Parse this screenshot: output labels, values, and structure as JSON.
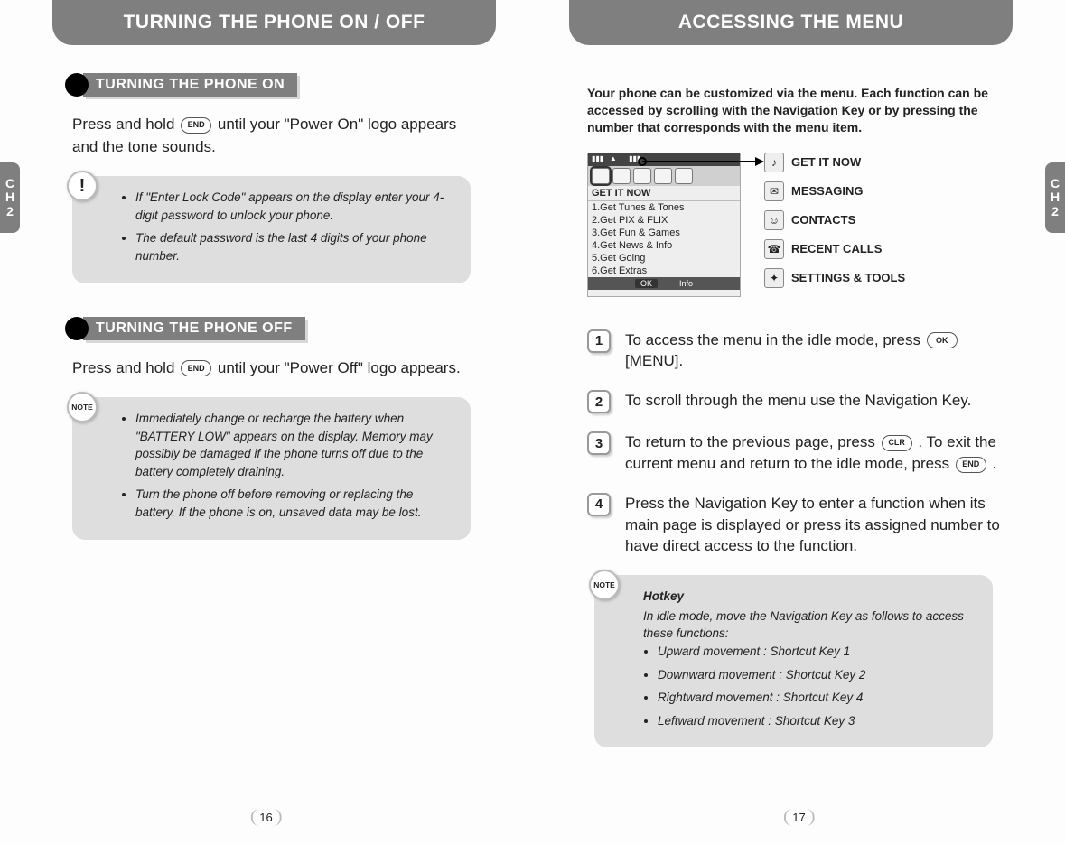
{
  "left": {
    "header": "TURNING THE PHONE ON / OFF",
    "side_tab": {
      "c": "C",
      "h": "H",
      "n": "2"
    },
    "sec1": {
      "title": "TURNING THE PHONE ON",
      "body_a": "Press and hold ",
      "key": "END",
      "body_b": " until your \"Power On\" logo appears and the tone sounds.",
      "note_badge": "!",
      "note_items": [
        "If \"Enter Lock Code\" appears on the display enter your 4-digit password to unlock your phone.",
        "The default password is the last 4 digits of your phone number."
      ]
    },
    "sec2": {
      "title": "TURNING THE PHONE OFF",
      "body_a": "Press and hold ",
      "key": "END",
      "body_b": " until your \"Power Off\" logo appears.",
      "note_badge": "NOTE",
      "note_items": [
        "Immediately change or recharge the battery when \"BATTERY LOW\" appears on the display. Memory may possibly be damaged if the phone turns off due to the battery completely draining.",
        "Turn the phone off before removing or replacing the battery. If the phone is on, unsaved data may be lost."
      ]
    },
    "page_num": "16"
  },
  "right": {
    "header": "ACCESSING THE MENU",
    "side_tab": {
      "c": "C",
      "h": "H",
      "n": "2"
    },
    "intro": "Your phone can be customized via the menu. Each function can be accessed by scrolling with the Navigation Key or by pressing the number that corresponds with the menu item.",
    "screen": {
      "title": "GET IT NOW",
      "options": [
        "1.Get Tunes & Tones",
        "2.Get PIX & FLIX",
        "3.Get Fun & Games",
        "4.Get News & Info",
        "5.Get Going",
        "6.Get Extras"
      ],
      "soft_ok": "OK",
      "soft_info": "Info"
    },
    "menu_items": [
      "GET IT NOW",
      "MESSAGING",
      "CONTACTS",
      "RECENT CALLS",
      "SETTINGS & TOOLS"
    ],
    "steps": {
      "s1a": "To access the menu in the idle mode, press ",
      "s1key": "OK",
      "s1b": " [MENU].",
      "s2": "To scroll through the menu use the Navigation Key.",
      "s3a": "To return to the previous page, press ",
      "s3key1": "CLR",
      "s3b": " . To exit the current menu and return to the idle mode, press ",
      "s3key2": "END",
      "s3c": " .",
      "s4": "Press the Navigation Key to enter a function when its main page is displayed or press its assigned number to have direct access to the function."
    },
    "hotkey": {
      "badge": "NOTE",
      "title": "Hotkey",
      "intro": "In idle mode, move the Navigation Key as follows to access these functions:",
      "items": [
        "Upward movement : Shortcut Key 1",
        "Downward movement : Shortcut Key 2",
        "Rightward movement : Shortcut Key 4",
        "Leftward movement : Shortcut Key 3"
      ]
    },
    "page_num": "17"
  }
}
